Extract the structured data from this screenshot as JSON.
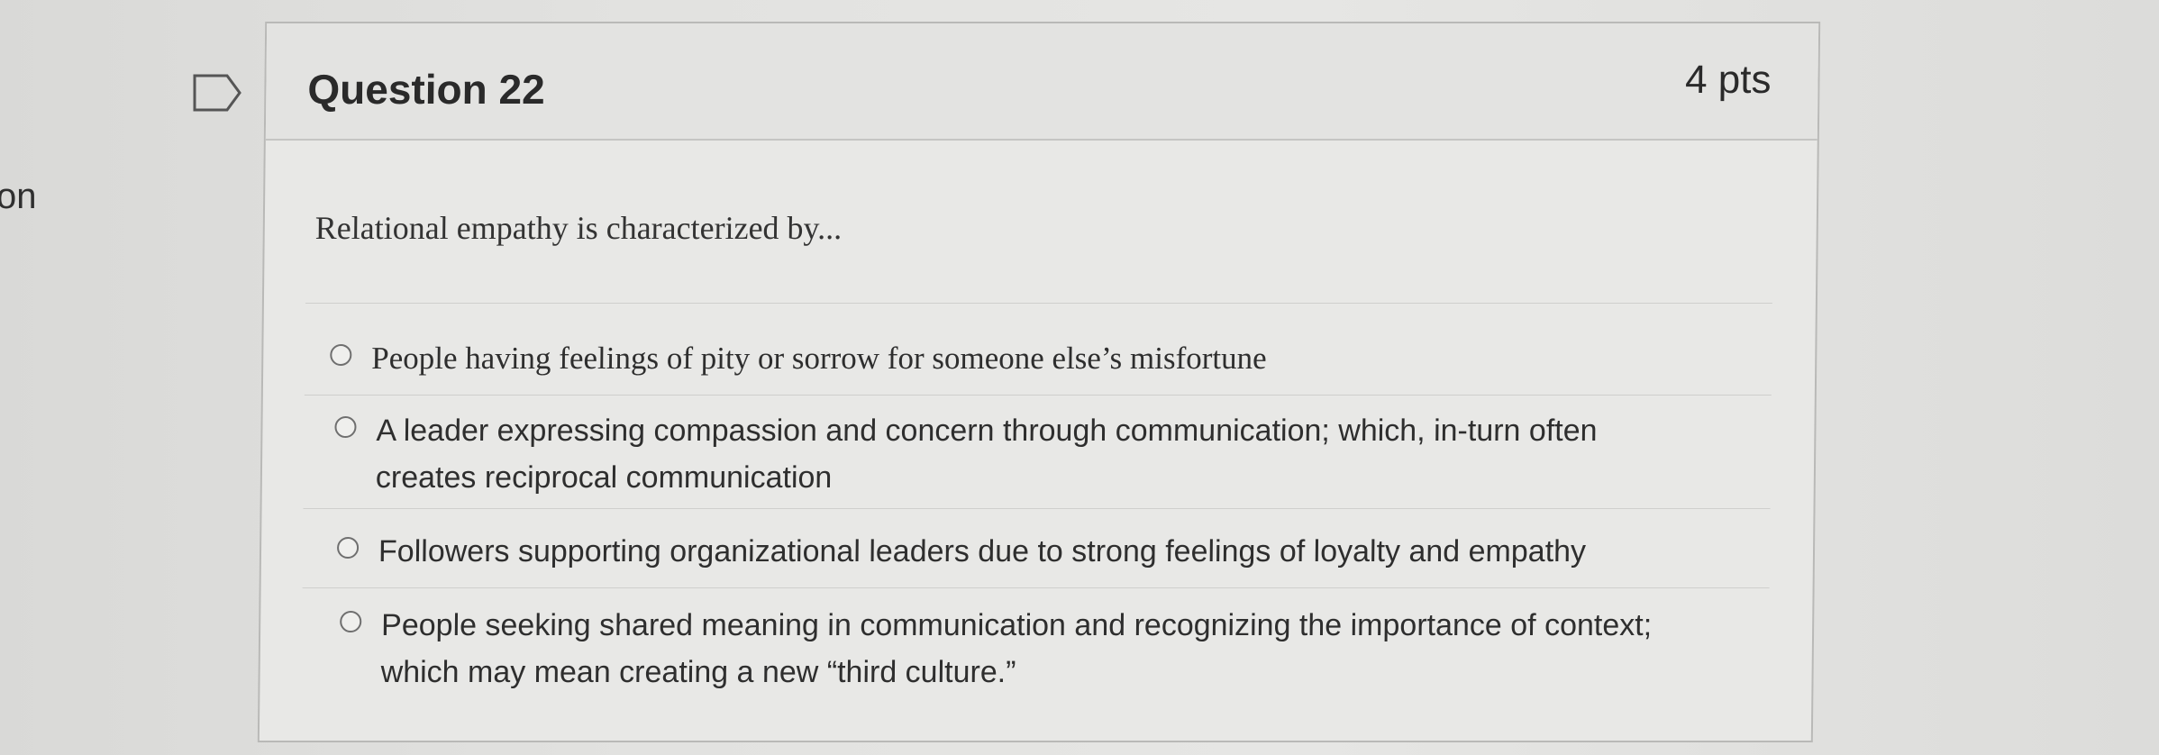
{
  "side": {
    "cut_text": "on"
  },
  "question": {
    "title": "Question 22",
    "points": "4 pts",
    "text": "Relational empathy is characterized by...",
    "answers": [
      {
        "label": "People having feelings of pity or sorrow for someone else’s misfortune"
      },
      {
        "label": "A leader expressing compassion and concern through communication; which, in-turn often creates reciprocal communication"
      },
      {
        "label": "Followers supporting organizational leaders due to strong feelings of loyalty and empathy"
      },
      {
        "label": "People seeking shared meaning in communication and recognizing the importance of context; which may mean creating a new “third culture.”"
      }
    ]
  }
}
